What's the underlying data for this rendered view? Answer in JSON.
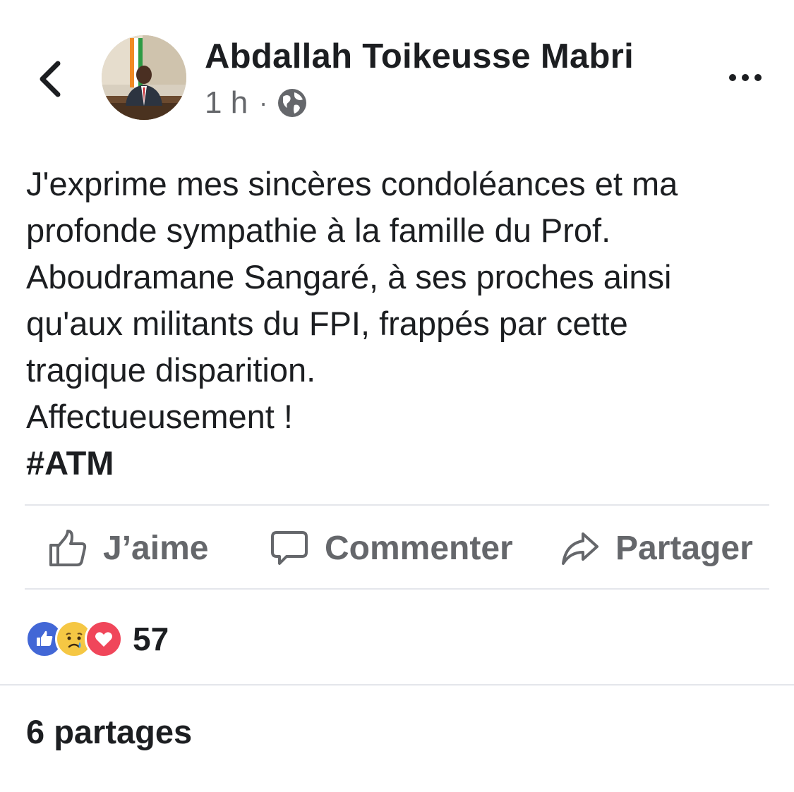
{
  "header": {
    "back_icon": "chevron-left-icon",
    "author_name": "Abdallah Toikeusse Mabri",
    "time": "1 h",
    "separator": "·",
    "privacy_icon": "globe-icon",
    "more_icon": "more-horizontal-icon"
  },
  "post": {
    "lines": [
      "J'exprime mes sincères condoléances et ma",
      "profonde sympathie à la famille du Prof.",
      "Aboudramane Sangaré, à ses proches ainsi",
      "qu'aux militants du FPI, frappés par cette",
      "tragique disparition.",
      "Affectueusement !"
    ],
    "hashtag": "#ATM"
  },
  "actions": {
    "like_label": "J’aime",
    "comment_label": "Commenter",
    "share_label": "Partager"
  },
  "reactions": {
    "icons": [
      "like-reaction-icon",
      "sad-reaction-icon",
      "love-reaction-icon"
    ],
    "count": "57"
  },
  "shares": {
    "label": "6 partages"
  },
  "colors": {
    "text": "#1c1e21",
    "secondary": "#65676b",
    "like_blue": "#4267d6",
    "sad_yellow": "#f5c744",
    "love_red": "#f0465a",
    "divider": "#e4e6eb"
  }
}
